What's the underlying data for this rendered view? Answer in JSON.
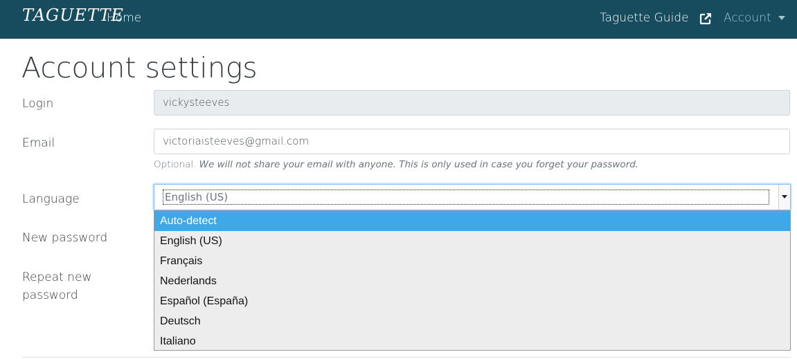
{
  "navbar": {
    "brand": "TAGUETTE",
    "home": "Home",
    "guide": "Taguette Guide",
    "guide_icon": "external-link-icon",
    "account": "Account",
    "account_icon": "caret-down-icon",
    "background": "#164c5e",
    "account_color": "#9fc3cf"
  },
  "page": {
    "title": "Account settings"
  },
  "form": {
    "login": {
      "label": "Login",
      "value": "vickysteeves"
    },
    "email": {
      "label": "Email",
      "value": "victoriaisteeves@gmail.com",
      "help_prefix": "Optional.",
      "help_text": "We will not share your email with anyone. This is only used in case you forget your password."
    },
    "language": {
      "label": "Language",
      "value": "English (US)",
      "options": [
        "Auto-detect",
        "English (US)",
        "Français",
        "Nederlands",
        "Español (España)",
        "Deutsch",
        "Italiano"
      ],
      "highlighted": "Auto-detect",
      "highlight_color": "#3ea9e9"
    },
    "new_password": {
      "label": "New password"
    },
    "repeat_password": {
      "label_line1": "Repeat new",
      "label_line2": "password"
    }
  }
}
